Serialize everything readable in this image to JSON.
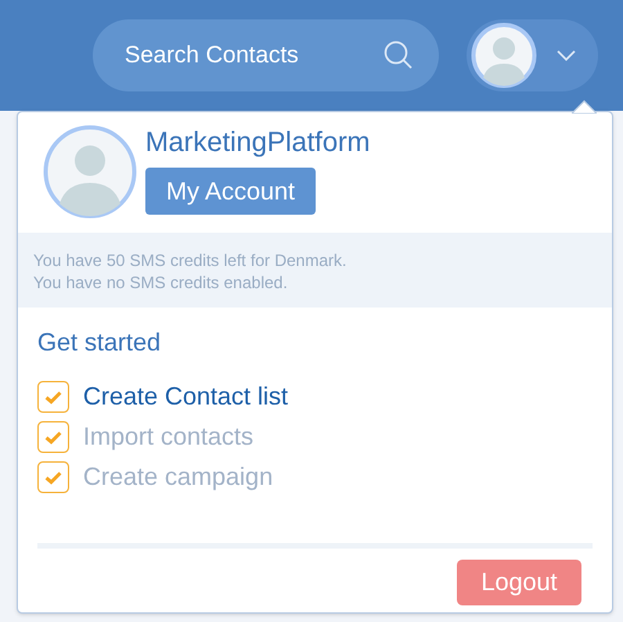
{
  "header": {
    "search": {
      "placeholder": "Search Contacts"
    }
  },
  "account_menu": {
    "name": "MarketingPlatform",
    "account_button": "My Account",
    "sms_notes": [
      "You have 50 SMS credits left for Denmark.",
      "You have no SMS credits enabled."
    ],
    "get_started": {
      "title": "Get started",
      "items": [
        {
          "label": "Create Contact list",
          "checked": true,
          "active": true
        },
        {
          "label": "Import contacts",
          "checked": true,
          "active": false
        },
        {
          "label": "Create campaign",
          "checked": true,
          "active": false
        }
      ]
    },
    "logout_button": "Logout"
  }
}
